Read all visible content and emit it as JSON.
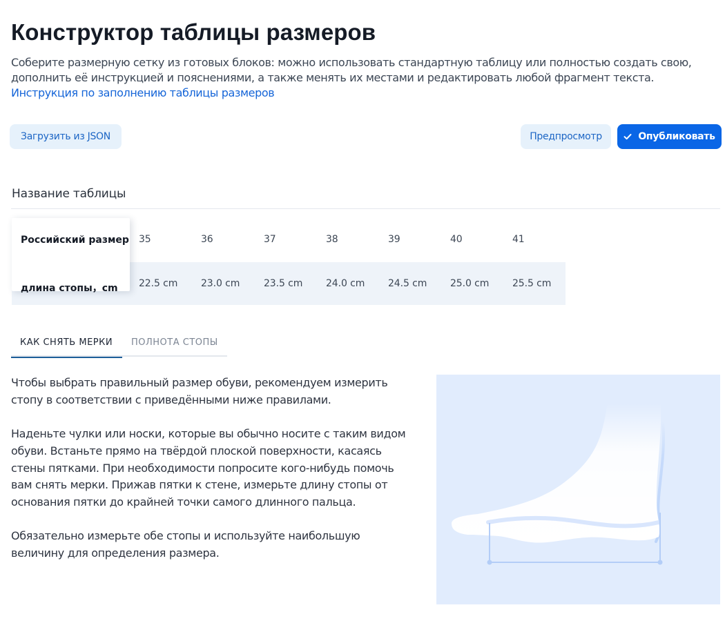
{
  "page": {
    "title": "Конструктор таблицы размеров",
    "intro_text": "Соберите размерную сетку из готовых блоков: можно использовать стандартную таблицу или полностью создать свою, дополнить её инструкцией и пояснениями, а также менять их местами и редактировать любой фрагмент текста. ",
    "intro_link": "Инструкция по заполнению таблицы размеров"
  },
  "toolbar": {
    "load_json_label": "Загрузить из JSON",
    "preview_label": "Предпросмотр",
    "publish_label": "Опубликовать",
    "publish_icon": "check-icon"
  },
  "table": {
    "name_label": "Название таблицы",
    "rows": [
      {
        "header": "Российский размер",
        "values": [
          "35",
          "36",
          "37",
          "38",
          "39",
          "40",
          "41"
        ]
      },
      {
        "header": "длина стопы，cm",
        "values": [
          "22.5 cm",
          "23.0 cm",
          "23.5 cm",
          "24.0 cm",
          "24.5 cm",
          "25.0 cm",
          "25.5 cm"
        ]
      }
    ]
  },
  "tabs": [
    {
      "label": "КАК СНЯТЬ МЕРКИ",
      "active": true
    },
    {
      "label": "ПОЛНОТА СТОПЫ",
      "active": false
    }
  ],
  "instructions": {
    "paragraphs": [
      "Чтобы выбрать правильный размер обуви, рекомендуем измерить стопу в соответствии с приведёнными ниже правилами.",
      "Наденьте чулки или носки, которые вы обычно носите с таким видом обуви. Встаньте прямо на твёрдой плоской поверхности, касаясь стены пятками. При необходимости попросите кого-нибудь помочь вам снять мерки. Прижав пятки к стене, измерьте длину стопы от основания пятки до крайней точки самого длинного пальца.",
      "Обязательно измерьте обе стопы и используйте наибольшую величину для определения размера."
    ]
  },
  "colors": {
    "accent": "#0a66e6",
    "light_button": "#e6f1fb",
    "link": "#1565d8",
    "illustration_bg": "#e1ecfd"
  }
}
